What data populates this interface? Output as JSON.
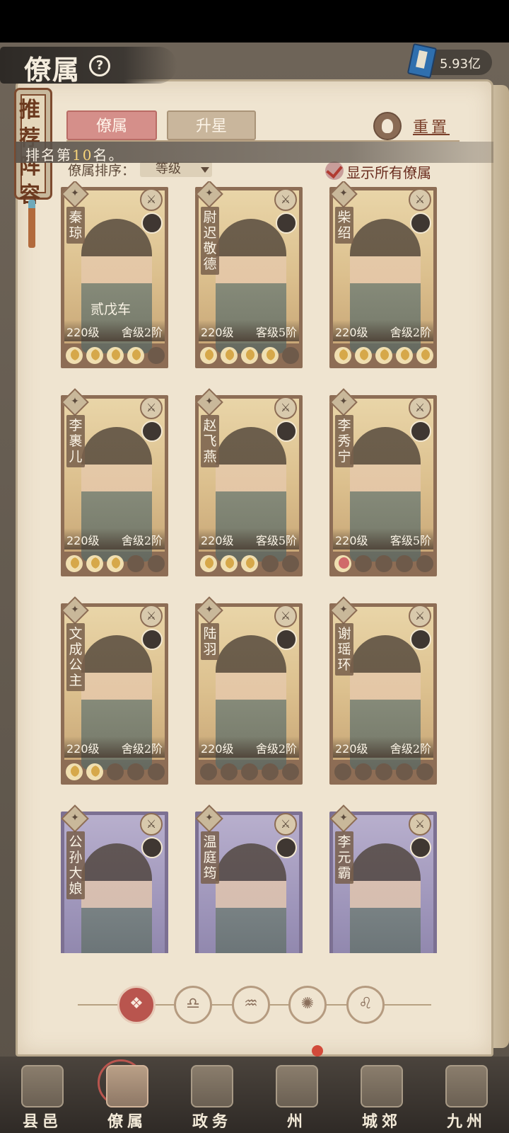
{
  "header": {
    "title": "僚属",
    "help_glyph": "?",
    "currency_value": "5.93亿",
    "currency_icon": "scroll-book-icon"
  },
  "recommend_banner": {
    "label": "推荐阵容"
  },
  "tabs": [
    {
      "label": "僚属",
      "active": true
    },
    {
      "label": "升星",
      "active": false
    }
  ],
  "reset": {
    "label": "重置",
    "icon": "reset-icon"
  },
  "rank_notice": {
    "prefix": "排名第",
    "number": "10",
    "suffix": "名。"
  },
  "sort": {
    "label": "僚属排序：",
    "value": "等级"
  },
  "show_all": {
    "label": "显示所有僚属",
    "checked": true
  },
  "cards": [
    {
      "name": "秦琼",
      "tag": "贰戊车",
      "level": "220级",
      "rank": "舍级2阶",
      "stars": [
        1,
        1,
        1,
        1,
        0
      ],
      "role_icon": "sword-icon",
      "cap_icon": "lion-icon",
      "theme": "gold"
    },
    {
      "name": "尉迟敬德",
      "tag": "",
      "level": "220级",
      "rank": "客级5阶",
      "stars": [
        1,
        1,
        1,
        1,
        0
      ],
      "role_icon": "sword-icon",
      "cap_icon": "lion-icon",
      "theme": "gold"
    },
    {
      "name": "柴绍",
      "tag": "",
      "level": "220级",
      "rank": "舍级2阶",
      "stars": [
        1,
        1,
        1,
        1,
        1
      ],
      "role_icon": "sword-icon",
      "cap_icon": "lion-icon",
      "theme": "gold"
    },
    {
      "name": "李裹儿",
      "tag": "",
      "level": "220级",
      "rank": "舍级2阶",
      "stars": [
        1,
        1,
        1,
        0,
        0
      ],
      "role_icon": "yinyang-icon",
      "cap_icon": "lion-icon",
      "theme": "gold"
    },
    {
      "name": "赵飞燕",
      "tag": "",
      "level": "220级",
      "rank": "客级5阶",
      "stars": [
        1,
        1,
        1,
        0,
        0
      ],
      "role_icon": "flower-icon",
      "cap_icon": "fan-icon",
      "theme": "gold"
    },
    {
      "name": "李秀宁",
      "tag": "",
      "level": "220级",
      "rank": "客级5阶",
      "stars": [
        2,
        0,
        0,
        0,
        0
      ],
      "role_icon": "sword-icon",
      "cap_icon": "lion-icon",
      "theme": "gold"
    },
    {
      "name": "文成公主",
      "tag": "",
      "level": "220级",
      "rank": "舍级2阶",
      "stars": [
        1,
        1,
        0,
        0,
        0
      ],
      "role_icon": "shield-icon",
      "cap_icon": "fan-icon",
      "theme": "gold"
    },
    {
      "name": "陆羽",
      "tag": "",
      "level": "220级",
      "rank": "舍级2阶",
      "stars": [
        0,
        0,
        0,
        0,
        0
      ],
      "role_icon": "book-icon",
      "cap_icon": "bell-icon",
      "theme": "gold"
    },
    {
      "name": "谢瑶环",
      "tag": "",
      "level": "220级",
      "rank": "舍级2阶",
      "stars": [
        0,
        0,
        0,
        0,
        0
      ],
      "role_icon": "sword-icon",
      "cap_icon": "bell-icon",
      "theme": "gold"
    },
    {
      "name": "公孙大娘",
      "tag": "",
      "level": "",
      "rank": "",
      "stars": [],
      "role_icon": "sword-icon",
      "cap_icon": "fan-icon",
      "theme": "purple"
    },
    {
      "name": "温庭筠",
      "tag": "",
      "level": "",
      "rank": "",
      "stars": [],
      "role_icon": "yinyang-icon",
      "cap_icon": "bell-icon",
      "theme": "purple"
    },
    {
      "name": "李元霸",
      "tag": "",
      "level": "",
      "rank": "",
      "stars": [],
      "role_icon": "shield-icon",
      "cap_icon": "bell-icon",
      "theme": "purple"
    }
  ],
  "filters": [
    {
      "name": "all-filter",
      "glyph": "❖",
      "active": true
    },
    {
      "name": "bell-filter",
      "glyph": "♎",
      "active": false
    },
    {
      "name": "cat-filter",
      "glyph": "♒",
      "active": false
    },
    {
      "name": "fan-filter",
      "glyph": "✺",
      "active": false
    },
    {
      "name": "lion-filter",
      "glyph": "♌",
      "active": false
    }
  ],
  "nav": [
    {
      "label": "县邑",
      "active": false
    },
    {
      "label": "僚属",
      "active": true
    },
    {
      "label": "政务",
      "active": false
    },
    {
      "label": "州",
      "active": false,
      "badge": true
    },
    {
      "label": "城郊",
      "active": false
    },
    {
      "label": "九州",
      "active": false
    }
  ],
  "colors": {
    "accent_red": "#b9554e",
    "page_bg": "#efe4d0",
    "card_gold": "#dcc08e",
    "card_purple": "#9e95ba"
  }
}
